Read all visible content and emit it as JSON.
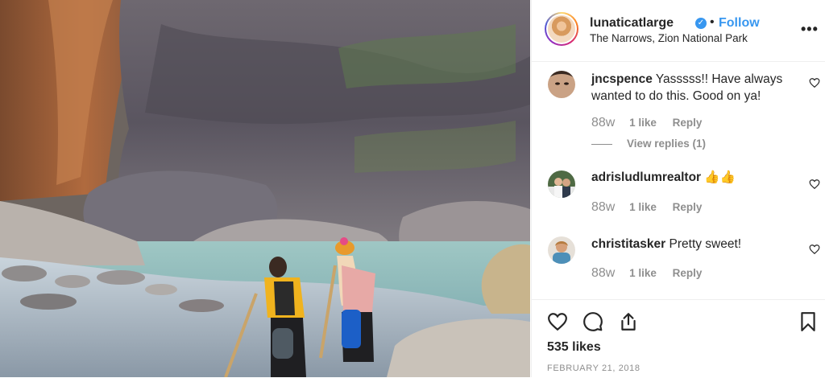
{
  "post": {
    "username": "lunaticatlarge",
    "follow_label": "Follow",
    "separator": "•",
    "location": "The Narrows, Zion National Park",
    "more_label": "•••",
    "verified_glyph": "✓"
  },
  "comments": [
    {
      "user": "jncspence",
      "text": "Yasssss!! Have always wanted to do this. Good on ya!",
      "time": "88w",
      "likes": "1 like",
      "reply_label": "Reply",
      "view_replies": "View replies (1)"
    },
    {
      "user": "adrisludlumrealtor",
      "text": "👍👍",
      "time": "88w",
      "likes": "1 like",
      "reply_label": "Reply"
    },
    {
      "user": "christitasker",
      "text": "Pretty sweet!",
      "time": "88w",
      "likes": "1 like",
      "reply_label": "Reply"
    }
  ],
  "footer": {
    "likes": "535 likes",
    "date": "FEBRUARY 21, 2018"
  },
  "icons": {
    "header": [
      "verified-badge-icon",
      "more-options-icon"
    ],
    "comments": [
      "heart-icon"
    ],
    "actions": [
      "heart-icon",
      "comment-icon",
      "share-icon",
      "bookmark-icon"
    ]
  },
  "colors": {
    "link_blue": "#3897f0",
    "muted_gray": "#8e8e8e",
    "text": "#262626"
  }
}
